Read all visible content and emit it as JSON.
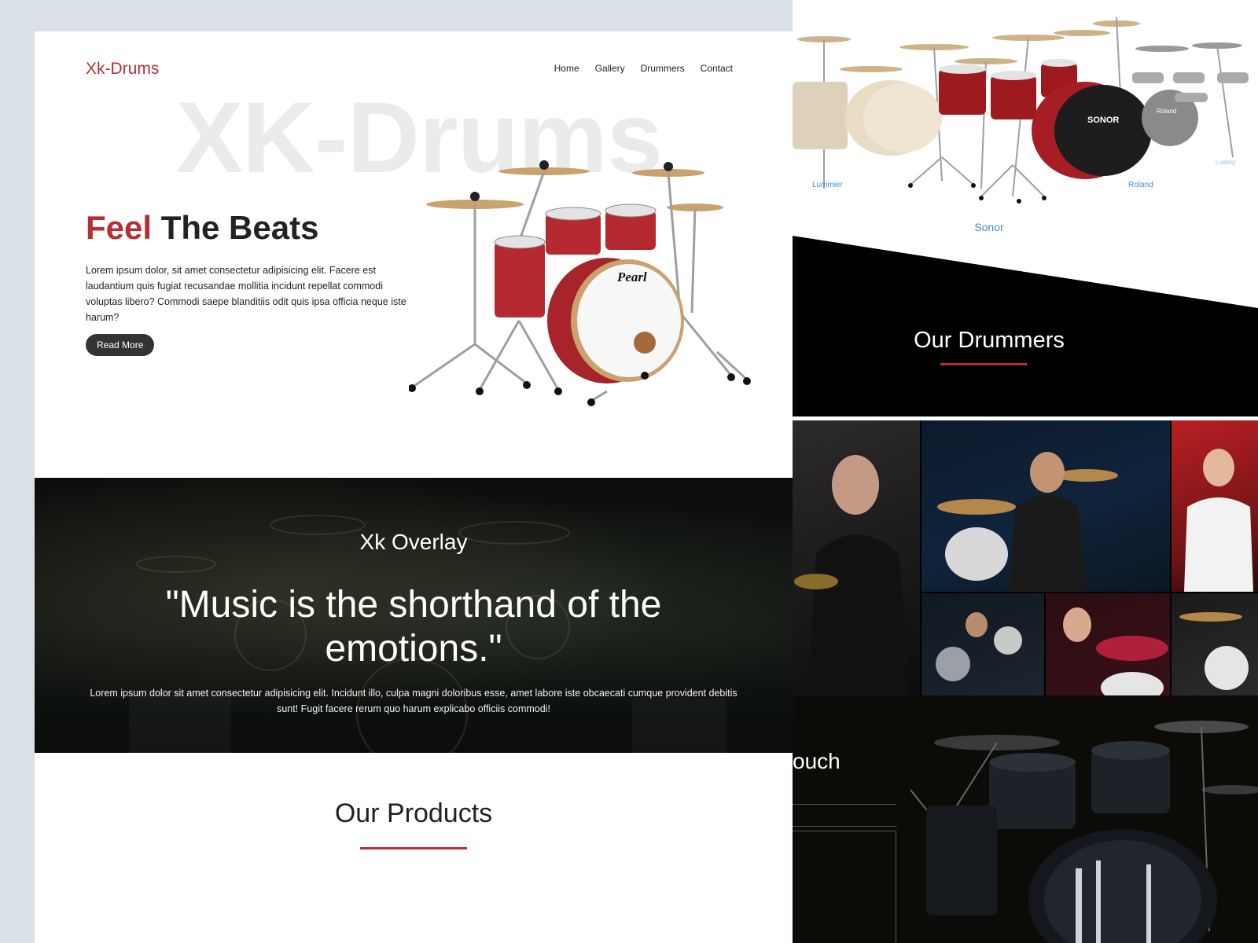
{
  "left": {
    "logo": "Xk-Drums",
    "nav": [
      "Home",
      "Gallery",
      "Drummers",
      "Contact"
    ],
    "watermark": "XK-Drums",
    "hero": {
      "heading_accent": "Feel",
      "heading_rest": " The Beats",
      "text": "Lorem ipsum dolor, sit amet consectetur adipisicing elit. Facere est laudantium quis fugiat recusandae mollitia incidunt repellat commodi voluptas libero? Commodi saepe blanditiis odit quis ipsa officia neque iste harum?",
      "button": "Read More",
      "kit_brand": "Pearl"
    },
    "overlay": {
      "title": "Xk Overlay",
      "quote": "\"Music is the shorthand of the emotions.\"",
      "text": "Lorem ipsum dolor sit amet consectetur adipisicing elit. Incidunt illo, culpa magni doloribus esse, amet labore iste obcaecati cumque provident debitis sunt! Fugit facere rerum quo harum explicabo officiis commodi!"
    },
    "products_title": "Our Products"
  },
  "right": {
    "brands": {
      "lummier": "Lummier",
      "roland": "Roland",
      "ludwig": "Ludwig",
      "sonor": "Sonor",
      "drum_badge_sonor": "SONOR",
      "drum_badge_roland": "Roland"
    },
    "drummers_title": "Our Drummers",
    "touch_text": "ouch"
  },
  "colors": {
    "accent": "#b62f34",
    "link": "#3d8fd4",
    "dark": "#000000"
  }
}
